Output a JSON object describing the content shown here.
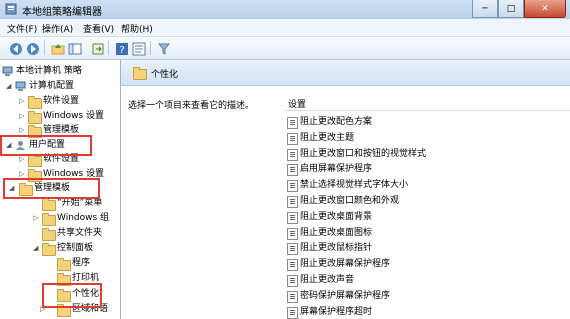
{
  "window": {
    "title": "本地组策略编辑器",
    "controls": {
      "minimize": "─",
      "maximize": "□",
      "close": "✕"
    }
  },
  "menu": [
    "文件(F)",
    "操作(A)",
    "查看(V)",
    "帮助(H)"
  ],
  "toolbar": [
    "back-icon",
    "forward-icon",
    "up-folder-icon",
    "show-hide-tree-icon",
    "export-icon",
    "help-icon",
    "properties-icon",
    "filter-icon"
  ],
  "tree": {
    "root": "本地计算机 策略",
    "computer_config": "计算机配置",
    "cc_software": "软件设置",
    "cc_windows": "Windows 设置",
    "cc_admin": "管理模板",
    "user_config": "用户配置",
    "uc_software": "软件设置",
    "uc_windows": "Windows 设置",
    "uc_admin": "管理模板",
    "start_menu": "“开始”菜单",
    "windows_comp": "Windows 组",
    "shared_folders": "共享文件夹",
    "control_panel": "控制面板",
    "programs": "程序",
    "printers": "打印机",
    "personalization": "个性化",
    "region_lang": "区域和语"
  },
  "detail": {
    "header": "个性化",
    "description": "选择一个项目来查看它的描述。",
    "column": "设置",
    "settings": [
      "阻止更改配色方案",
      "阻止更改主题",
      "阻止更改窗口和按钮的视觉样式",
      "启用屏幕保护程序",
      "禁止选择视觉样式字体大小",
      "阻止更改窗口颜色和外观",
      "阻止更改桌面背景",
      "阻止更改桌面图标",
      "阻止更改鼠标指针",
      "阻止更改屏幕保护程序",
      "阻止更改声音",
      "密码保护屏幕保护程序",
      "屏幕保护程序超时"
    ]
  },
  "colors": {
    "highlight": "#e23a34",
    "folder": "#f3d27a",
    "title_bar": "#b9d1ea"
  }
}
